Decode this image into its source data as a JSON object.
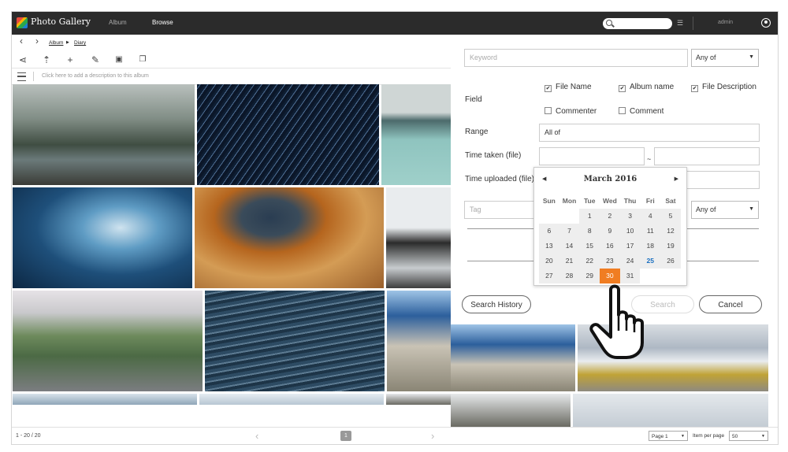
{
  "header": {
    "app_title": "Photo Gallery",
    "nav_album": "Album",
    "nav_browse": "Browse",
    "user": "admin"
  },
  "breadcrumb": {
    "root": "Album",
    "current": "Diary"
  },
  "description_placeholder": "Click here to add a description to this album",
  "search": {
    "keyword_placeholder": "Keyword",
    "keyword_match": "Any of",
    "field_label": "Field",
    "fields": [
      {
        "label": "File Name",
        "checked": true
      },
      {
        "label": "Album name",
        "checked": true
      },
      {
        "label": "File Description",
        "checked": true
      },
      {
        "label": "Commenter",
        "checked": false
      },
      {
        "label": "Comment",
        "checked": false
      }
    ],
    "range_label": "Range",
    "range_value": "All of",
    "time_taken_label": "Time taken (file)",
    "time_uploaded_label": "Time uploaded (file)",
    "date_separator": "~",
    "tag_placeholder": "Tag",
    "tag_match": "Any of",
    "history_button": "Search History",
    "search_button": "Search",
    "cancel_button": "Cancel"
  },
  "calendar": {
    "month_label": "March  2016",
    "weekdays": [
      "Sun",
      "Mon",
      "Tue",
      "Wed",
      "Thu",
      "Fri",
      "Sat"
    ],
    "leading_blanks": 2,
    "days_in_month": 31,
    "today": 25,
    "selected": 30
  },
  "footer": {
    "count": "1 - 20 / 20",
    "current_page": "1",
    "page_select": "Page 1",
    "per_page_label": "Item per page",
    "per_page_value": "50"
  },
  "icons": [
    "back-icon",
    "forward-icon",
    "share-icon",
    "upload-icon",
    "add-icon",
    "edit-icon",
    "slideshow-icon",
    "copy-icon",
    "menu-icon",
    "search-icon",
    "filter-icon",
    "user-icon",
    "hand-cursor-icon"
  ]
}
